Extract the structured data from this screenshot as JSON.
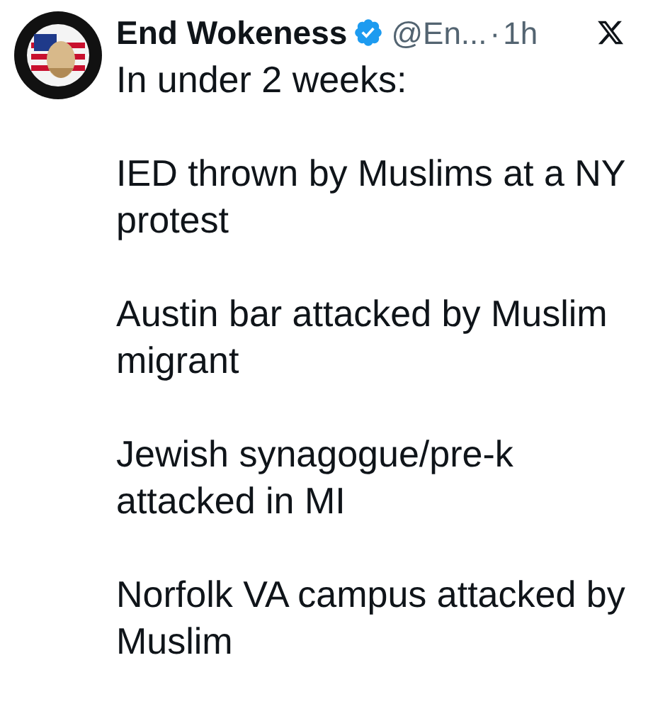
{
  "author": {
    "name": "End Wokeness",
    "verified": true,
    "handle": "@En...",
    "separator": "·",
    "time": "1h"
  },
  "paragraphs": [
    "In under 2 weeks:",
    "IED thrown by Muslims at a NY protest",
    "Austin bar attacked by Muslim migrant",
    "Jewish synagogue/pre-k attacked in MI",
    "Norfolk VA campus attacked by Muslim"
  ]
}
